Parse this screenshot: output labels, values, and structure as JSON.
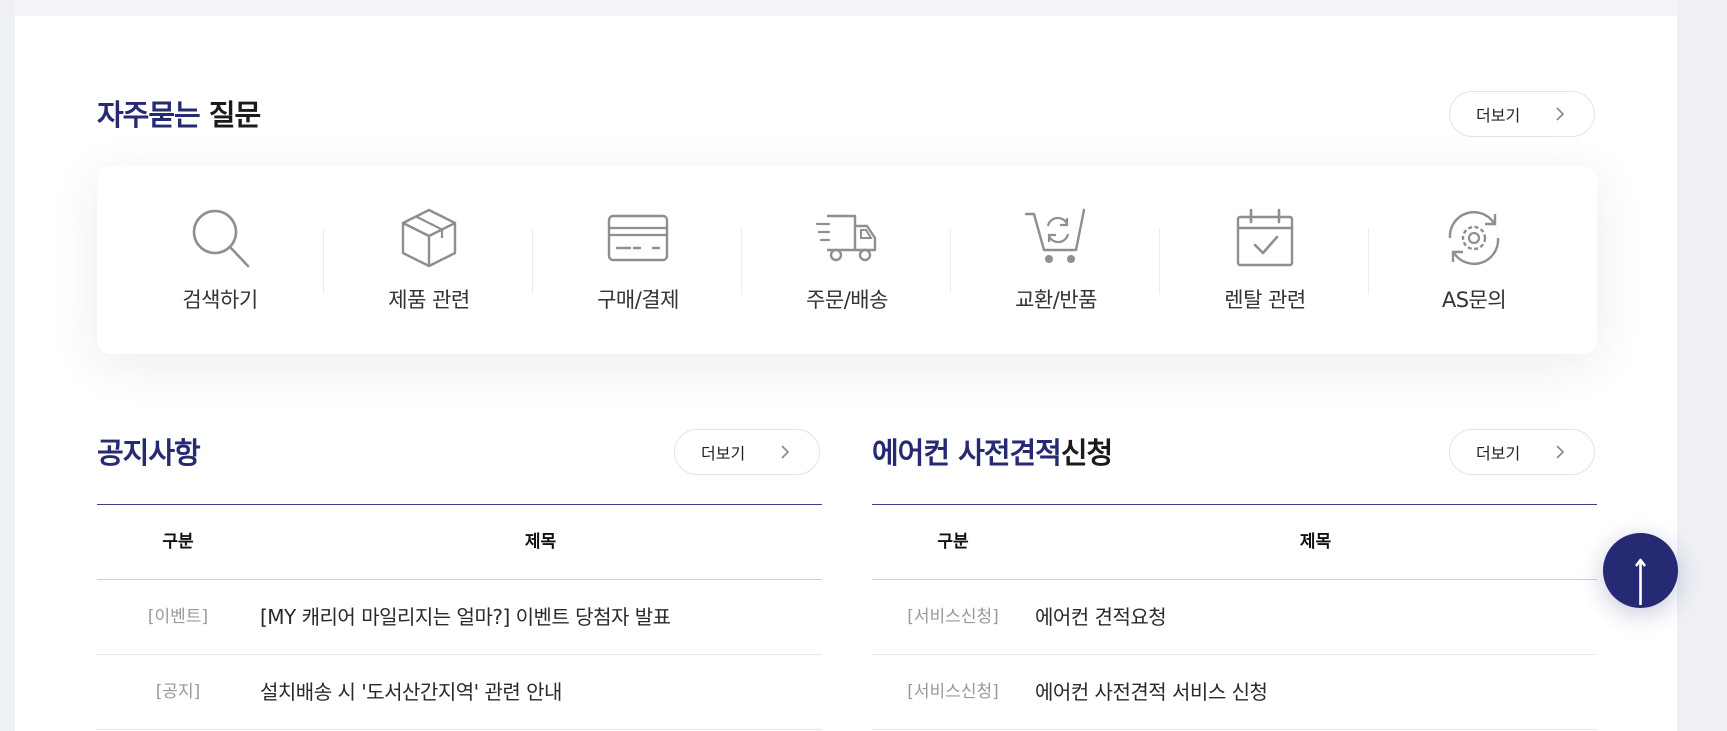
{
  "faq": {
    "title_accent": "자주묻는",
    "title_rest": " 질문",
    "more_label": "더보기",
    "items": [
      {
        "label": "검색하기",
        "icon": "search-icon"
      },
      {
        "label": "제품 관련",
        "icon": "box-icon"
      },
      {
        "label": "구매/결제",
        "icon": "credit-card-icon"
      },
      {
        "label": "주문/배송",
        "icon": "delivery-truck-icon"
      },
      {
        "label": "교환/반품",
        "icon": "cart-exchange-icon"
      },
      {
        "label": "렌탈 관련",
        "icon": "calendar-check-icon"
      },
      {
        "label": "AS문의",
        "icon": "gear-refresh-icon"
      }
    ]
  },
  "notice": {
    "title_accent": "공지사항",
    "title_rest": "",
    "more_label": "더보기",
    "columns": [
      "구분",
      "제목"
    ],
    "rows": [
      {
        "category": "[이벤트]",
        "title": "[MY 캐리어 마일리지는 얼마?] 이벤트 당첨자 발표"
      },
      {
        "category": "[공지]",
        "title": "설치배송 시 '도서산간지역' 관련 안내"
      }
    ]
  },
  "estimate": {
    "title_accent": "에어컨 사전견적",
    "title_rest": "신청",
    "more_label": "더보기",
    "columns": [
      "구분",
      "제목"
    ],
    "rows": [
      {
        "category": "[서비스신청]",
        "title": "에어컨 견적요청"
      },
      {
        "category": "[서비스신청]",
        "title": "에어컨 사전견적 서비스 신청"
      }
    ]
  },
  "colors": {
    "accent": "#262a72",
    "text": "#1b1b1b",
    "muted": "#999999"
  },
  "scroll_top": {
    "icon": "arrow-up-icon"
  }
}
